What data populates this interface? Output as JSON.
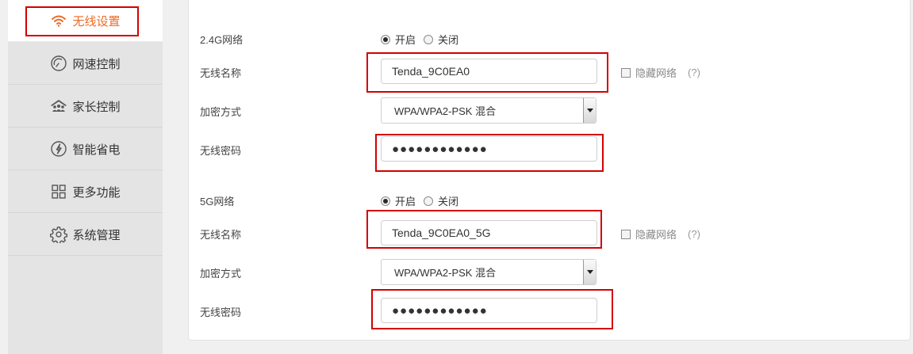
{
  "sidebar": {
    "items": [
      {
        "label": "无线设置",
        "icon": "wifi-icon",
        "active": true
      },
      {
        "label": "网速控制",
        "icon": "speedometer-icon"
      },
      {
        "label": "家长控制",
        "icon": "family-icon"
      },
      {
        "label": "智能省电",
        "icon": "power-saving-icon"
      },
      {
        "label": "更多功能",
        "icon": "grid-icon"
      },
      {
        "label": "系统管理",
        "icon": "gear-icon"
      }
    ]
  },
  "colors": {
    "accent": "#ee6a25",
    "highlight": "#d40000"
  },
  "wifi24": {
    "network_label": "2.4G网络",
    "on_label": "开启",
    "off_label": "关闭",
    "ssid_label": "无线名称",
    "ssid_value": "Tenda_9C0EA0",
    "hide_label": "隐藏网络",
    "help_label": "(?)",
    "encryption_label": "加密方式",
    "encryption_value": "WPA/WPA2-PSK 混合",
    "password_label": "无线密码",
    "password_value": "●●●●●●●●●●●●"
  },
  "wifi5": {
    "network_label": "5G网络",
    "on_label": "开启",
    "off_label": "关闭",
    "ssid_label": "无线名称",
    "ssid_value": "Tenda_9C0EA0_5G",
    "hide_label": "隐藏网络",
    "help_label": "(?)",
    "encryption_label": "加密方式",
    "encryption_value": "WPA/WPA2-PSK 混合",
    "password_label": "无线密码",
    "password_value": "●●●●●●●●●●●●"
  }
}
